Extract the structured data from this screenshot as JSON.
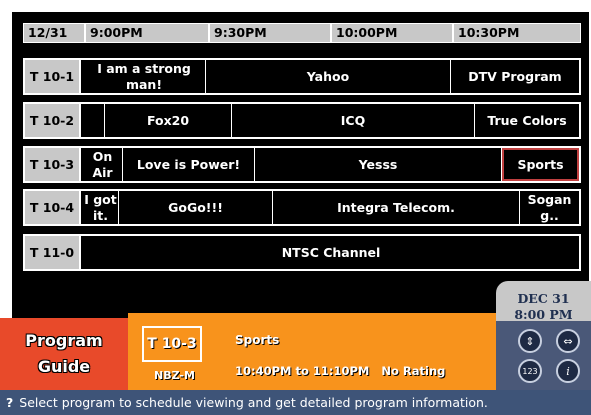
{
  "header": {
    "date": "12/31",
    "times": [
      "9:00PM",
      "9:30PM",
      "10:00PM",
      "10:30PM"
    ]
  },
  "rows": [
    {
      "channel": "T 10-1",
      "programs": [
        "I am a strong man!",
        "Yahoo",
        "DTV Program"
      ]
    },
    {
      "channel": "T 10-2",
      "programs": [
        "",
        "Fox20",
        "ICQ",
        "True Colors"
      ]
    },
    {
      "channel": "T 10-3",
      "programs": [
        "On Air",
        "Love is Power!",
        "Yesss",
        "Sports"
      ]
    },
    {
      "channel": "T 10-4",
      "programs": [
        "I got it.",
        "GoGo!!!",
        "Integra Telecom.",
        "Sogan g.."
      ]
    },
    {
      "channel": "T 11-0",
      "programs": [
        "NTSC Channel"
      ]
    }
  ],
  "clock": {
    "date": "DEC 31",
    "time": "8:00 PM"
  },
  "guide_title_1": "Program",
  "guide_title_2": "Guide",
  "selected": {
    "channel": "T 10-3",
    "network": "NBZ-M",
    "program": "Sports",
    "time": "10:40PM to 11:10PM",
    "rating": "No Rating"
  },
  "controls": {
    "b1": "⇕",
    "b2": "⇔",
    "b3": "123",
    "b4": "i"
  },
  "help": {
    "icon": "?",
    "text": "Select program to schedule viewing and get detailed program information."
  },
  "colors": {
    "selection": "#c04040",
    "orange": "#f8931c",
    "red": "#e84a2a",
    "bar": "#3e5478"
  }
}
